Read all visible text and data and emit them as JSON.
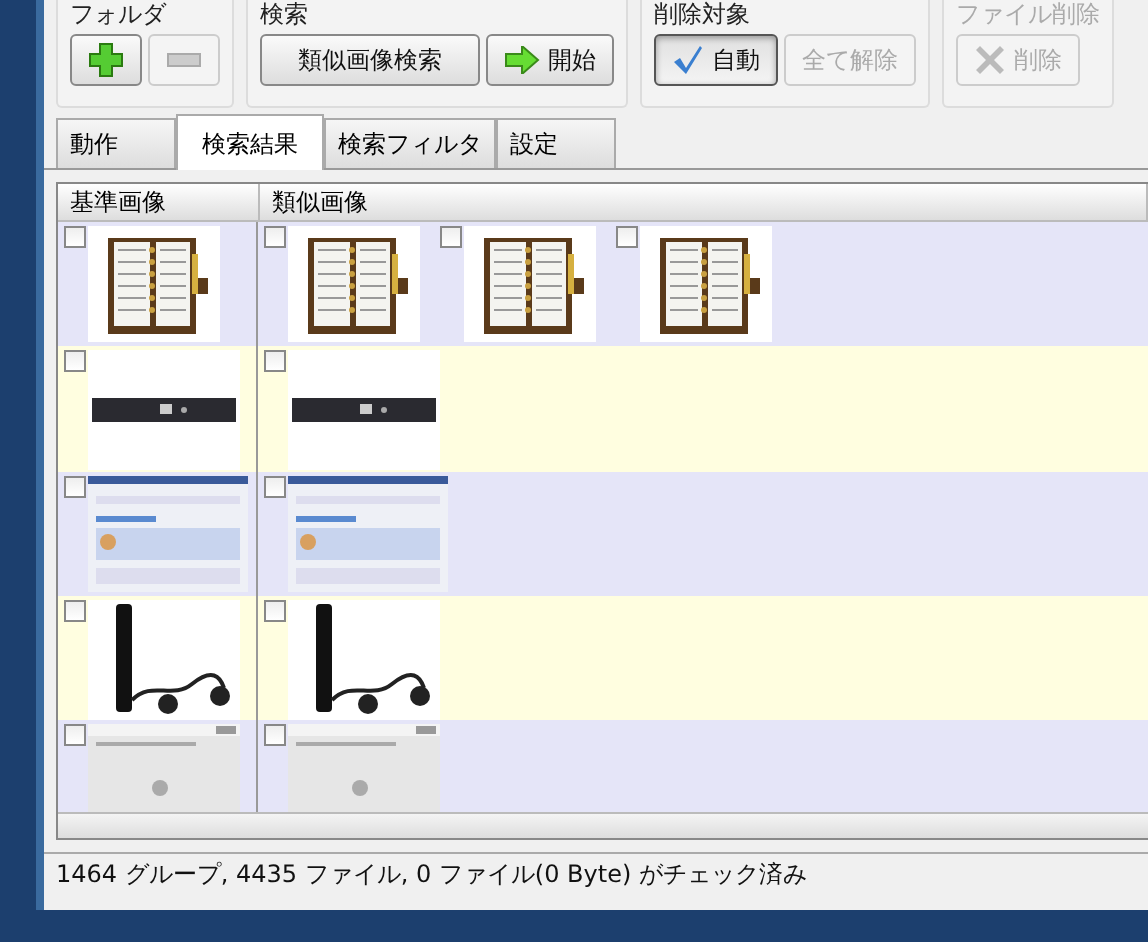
{
  "toolbar": {
    "groups": [
      {
        "title": "フォルダ",
        "disabled": false,
        "buttons": [
          {
            "kind": "plus",
            "disabled": false,
            "pressed": false
          },
          {
            "kind": "minus",
            "disabled": true,
            "pressed": false
          }
        ]
      },
      {
        "title": "検索",
        "disabled": false,
        "buttons": [
          {
            "kind": "text",
            "label": "類似画像検索",
            "disabled": false,
            "pressed": false
          },
          {
            "kind": "arrow",
            "label": "開始",
            "disabled": false,
            "pressed": false
          }
        ]
      },
      {
        "title": "削除対象",
        "disabled": false,
        "buttons": [
          {
            "kind": "check",
            "label": "自動",
            "disabled": false,
            "pressed": true
          },
          {
            "kind": "text",
            "label": "全て解除",
            "disabled": true,
            "pressed": false
          }
        ]
      },
      {
        "title": "ファイル削除",
        "disabled": true,
        "buttons": [
          {
            "kind": "cross",
            "label": "削除",
            "disabled": true,
            "pressed": false
          }
        ]
      }
    ]
  },
  "tabs": [
    {
      "label": "動作",
      "selected": false
    },
    {
      "label": "検索結果",
      "selected": true
    },
    {
      "label": "検索フィルタ",
      "selected": false
    },
    {
      "label": "設定",
      "selected": false
    }
  ],
  "table": {
    "columns": [
      "基準画像",
      "類似画像"
    ],
    "rows": [
      {
        "base": {
          "kind": "notebook",
          "checked": false
        },
        "similar": [
          {
            "kind": "notebook",
            "checked": false
          },
          {
            "kind": "notebook",
            "checked": false
          },
          {
            "kind": "notebook",
            "checked": false
          }
        ]
      },
      {
        "base": {
          "kind": "device",
          "checked": false
        },
        "similar": [
          {
            "kind": "device",
            "checked": false
          }
        ]
      },
      {
        "base": {
          "kind": "screenshot",
          "checked": false
        },
        "similar": [
          {
            "kind": "screenshot",
            "checked": false
          }
        ]
      },
      {
        "base": {
          "kind": "player",
          "checked": false
        },
        "similar": [
          {
            "kind": "player",
            "checked": false
          }
        ]
      },
      {
        "base": {
          "kind": "dialog",
          "checked": false
        },
        "similar": [
          {
            "kind": "dialog",
            "checked": false
          }
        ]
      }
    ]
  },
  "status_bar": "1464 グループ, 4435 ファイル, 0 ファイル(0 Byte) がチェック済み"
}
